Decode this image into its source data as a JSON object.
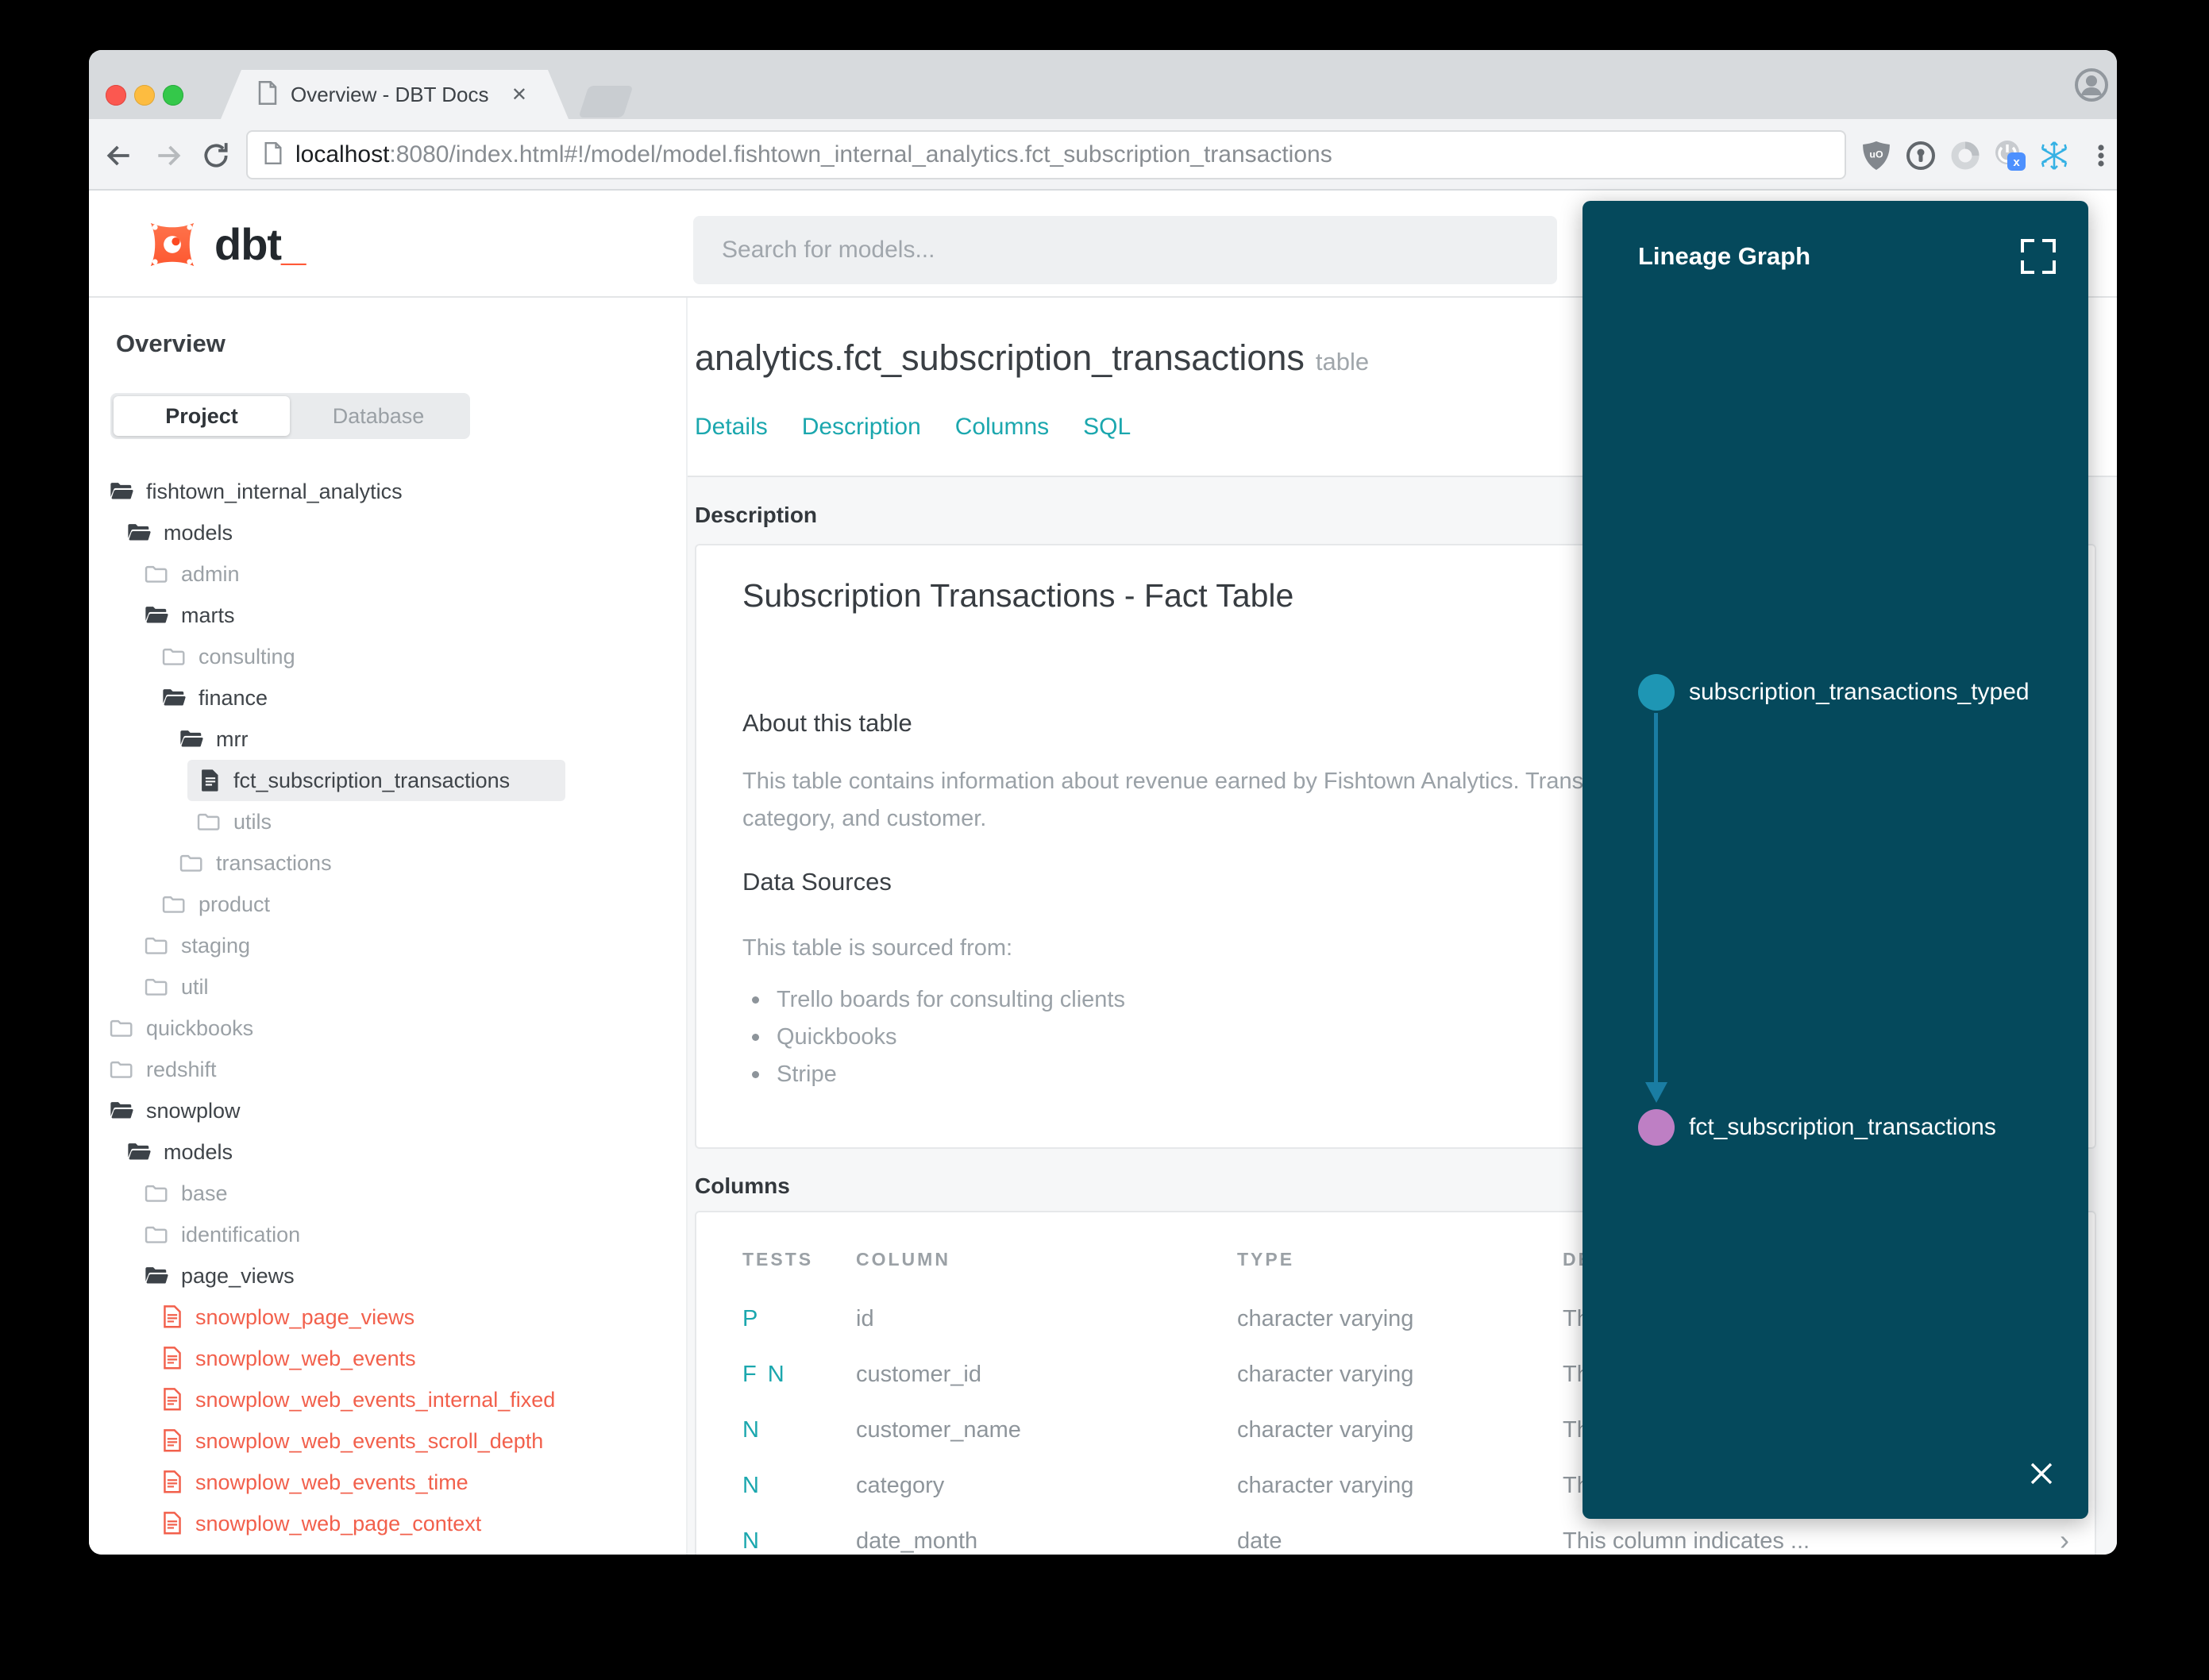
{
  "browser": {
    "tab_title": "Overview - DBT Docs",
    "url_host": "localhost",
    "url_rest": ":8080/index.html#!/model/model.fishtown_internal_analytics.fct_subscription_transactions",
    "extensions": [
      "ublock-shield",
      "onepassword",
      "loop",
      "power-x-badge",
      "snowflake",
      "menu-dots"
    ]
  },
  "header": {
    "logo_text": "dbt",
    "logo_underscore": "_",
    "search_placeholder": "Search for models..."
  },
  "sidebar": {
    "title": "Overview",
    "tabs": {
      "project": "Project",
      "database": "Database"
    },
    "tree": [
      {
        "label": "fishtown_internal_analytics",
        "level": 0,
        "icon": "folder-open"
      },
      {
        "label": "models",
        "level": 1,
        "icon": "folder-open"
      },
      {
        "label": "admin",
        "level": 2,
        "icon": "folder-closed"
      },
      {
        "label": "marts",
        "level": 2,
        "icon": "folder-open"
      },
      {
        "label": "consulting",
        "level": 3,
        "icon": "folder-closed"
      },
      {
        "label": "finance",
        "level": 3,
        "icon": "folder-open"
      },
      {
        "label": "mrr",
        "level": 4,
        "icon": "folder-open"
      },
      {
        "label": "fct_subscription_transactions",
        "level": 5,
        "icon": "model",
        "selected": true
      },
      {
        "label": "utils",
        "level": 5,
        "icon": "folder-closed"
      },
      {
        "label": "transactions",
        "level": 4,
        "icon": "folder-closed"
      },
      {
        "label": "product",
        "level": 3,
        "icon": "folder-closed"
      },
      {
        "label": "staging",
        "level": 2,
        "icon": "folder-closed"
      },
      {
        "label": "util",
        "level": 2,
        "icon": "folder-closed"
      },
      {
        "label": "quickbooks",
        "level": 0,
        "icon": "folder-closed"
      },
      {
        "label": "redshift",
        "level": 0,
        "icon": "folder-closed"
      },
      {
        "label": "snowplow",
        "level": 0,
        "icon": "folder-open"
      },
      {
        "label": "models",
        "level": 1,
        "icon": "folder-open"
      },
      {
        "label": "base",
        "level": 2,
        "icon": "folder-closed"
      },
      {
        "label": "identification",
        "level": 2,
        "icon": "folder-closed"
      },
      {
        "label": "page_views",
        "level": 2,
        "icon": "folder-open"
      },
      {
        "label": "snowplow_page_views",
        "level": 3,
        "icon": "model-error"
      },
      {
        "label": "snowplow_web_events",
        "level": 3,
        "icon": "model-error"
      },
      {
        "label": "snowplow_web_events_internal_fixed",
        "level": 3,
        "icon": "model-error"
      },
      {
        "label": "snowplow_web_events_scroll_depth",
        "level": 3,
        "icon": "model-error"
      },
      {
        "label": "snowplow_web_events_time",
        "level": 3,
        "icon": "model-error"
      },
      {
        "label": "snowplow_web_page_context",
        "level": 3,
        "icon": "model-error"
      }
    ]
  },
  "main": {
    "title": "analytics.fct_subscription_transactions",
    "title_badge": "table",
    "nav": [
      "Details",
      "Description",
      "Columns",
      "SQL"
    ],
    "description_section_label": "Description",
    "doc": {
      "heading": "Subscription Transactions - Fact Table",
      "about_heading": "About this table",
      "about_line1": "This table contains information about revenue earned by Fishtown Analytics. Transactions are segmented by type,",
      "about_line2": "category, and customer.",
      "sources_heading": "Data Sources",
      "sources_intro": "This table is sourced from:",
      "sources": [
        "Trello boards for consulting clients",
        "Quickbooks",
        "Stripe"
      ]
    },
    "columns_section_label": "Columns",
    "columns_table": {
      "headers": [
        "TESTS",
        "COLUMN",
        "TYPE",
        "DESCRIPTION"
      ],
      "rows": [
        {
          "tests": [
            "P"
          ],
          "column": "id",
          "type": "character varying",
          "description": "This column indicates ..."
        },
        {
          "tests": [
            "F",
            "N"
          ],
          "column": "customer_id",
          "type": "character varying",
          "description": "This column indicates ..."
        },
        {
          "tests": [
            "N"
          ],
          "column": "customer_name",
          "type": "character varying",
          "description": "This column indicates ..."
        },
        {
          "tests": [
            "N"
          ],
          "column": "category",
          "type": "character varying",
          "description": "This column indicates ..."
        },
        {
          "tests": [
            "N"
          ],
          "column": "date_month",
          "type": "date",
          "description": "This column indicates ..."
        }
      ]
    }
  },
  "lineage": {
    "title": "Lineage Graph",
    "nodes": [
      {
        "label": "subscription_transactions_typed",
        "color": "#1e96b4"
      },
      {
        "label": "fct_subscription_transactions",
        "color": "#be7fc4"
      }
    ],
    "edge_color": "#1a7da3"
  },
  "colors": {
    "accent_teal": "#1ba7ae",
    "panel_bg": "#05495c",
    "model_error_red": "#f2604c",
    "dbt_orange": "#ff5a38"
  }
}
